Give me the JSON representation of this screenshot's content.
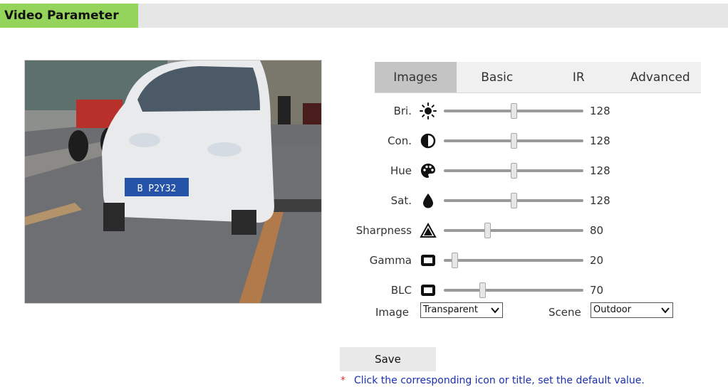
{
  "header": {
    "title": "Video Parameter"
  },
  "preview": {
    "plate_text": "B P2Y32"
  },
  "tabs": [
    {
      "label": "Images",
      "active": true
    },
    {
      "label": "Basic",
      "active": false
    },
    {
      "label": "IR",
      "active": false
    },
    {
      "label": "Advanced",
      "active": false
    }
  ],
  "params": [
    {
      "label": "Bri.",
      "icon": "sun-icon",
      "value": "128",
      "max": 255
    },
    {
      "label": "Con.",
      "icon": "contrast-icon",
      "value": "128",
      "max": 255
    },
    {
      "label": "Hue",
      "icon": "palette-icon",
      "value": "128",
      "max": 255
    },
    {
      "label": "Sat.",
      "icon": "droplet-icon",
      "value": "128",
      "max": 255
    },
    {
      "label": "Sharpness",
      "icon": "triangle-icon",
      "value": "80",
      "max": 255
    },
    {
      "label": "Gamma",
      "icon": "screen-icon",
      "value": "20",
      "max": 255
    },
    {
      "label": "BLC",
      "icon": "screen-icon",
      "value": "70",
      "max": 255
    }
  ],
  "selects": {
    "image": {
      "label": "Image",
      "value": "Transparent"
    },
    "scene": {
      "label": "Scene",
      "value": "Outdoor"
    }
  },
  "save_label": "Save",
  "hint": {
    "marker": "*",
    "text": "Click the corresponding icon or title, set the default value."
  },
  "colors": {
    "header_accent": "#95d45a",
    "hint_text": "#1a2fb0",
    "hint_marker": "#e03030"
  }
}
